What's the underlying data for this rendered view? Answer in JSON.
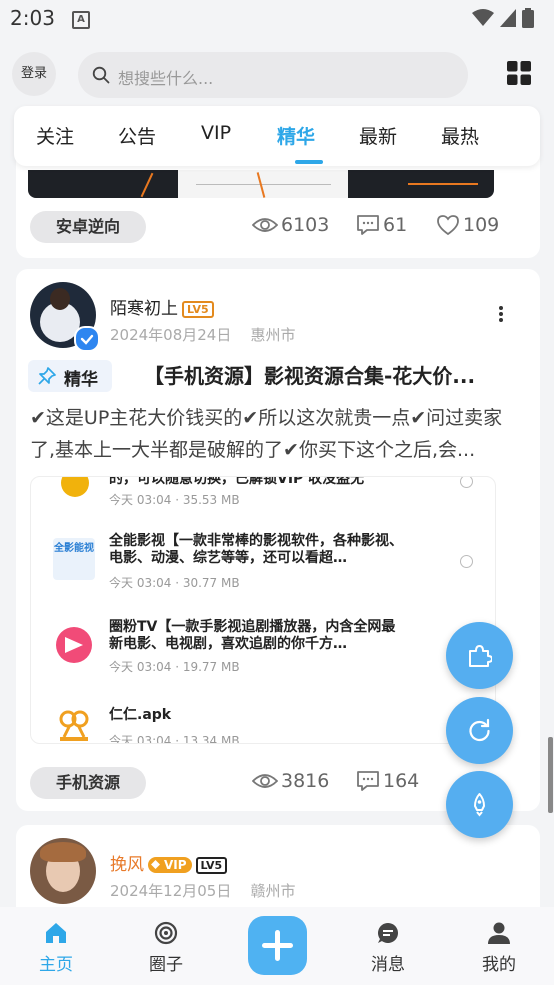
{
  "status_bar": {
    "time": "2:03",
    "notification_badge": "A"
  },
  "header": {
    "login_label": "登录",
    "search_placeholder": "想搜些什么..."
  },
  "tabs": [
    {
      "label": "关注"
    },
    {
      "label": "公告"
    },
    {
      "label": "VIP"
    },
    {
      "label": "精华",
      "active": true
    },
    {
      "label": "最新"
    },
    {
      "label": "最热"
    }
  ],
  "card1": {
    "tag": "安卓逆向",
    "views": "6103",
    "comments": "61",
    "likes": "109"
  },
  "card2": {
    "user": "陌寒初上",
    "level": "LV5",
    "date": "2024年08月24日",
    "location": "惠州市",
    "badge": "精华",
    "title": "【手机资源】影视资源合集-花大价...",
    "body": "✔这是UP主花大价钱买的✔所以这次就贵一点✔问过卖家了,基本上一大半都是破解的了✔你买下这个之后,会...",
    "files": [
      {
        "title": "的，可以随意切换，已解锁VIP 收没盗无",
        "meta": "今天 03:04 · 35.53 MB"
      },
      {
        "title": "全能影视【一款非常棒的影视软件，各种影视、电影、动漫、综艺等等，还可以看超…",
        "meta": "今天 03:04 · 30.77 MB",
        "icon_text": "全影能视"
      },
      {
        "title": "圈粉TV【一款手影视追剧播放器，内含全网最新电影、电视剧，喜欢追剧的你千方…",
        "meta": "今天 03:04 · 19.77 MB"
      },
      {
        "title": "仁仁.apk",
        "meta": "今天 03:04 · 13.34 MB"
      }
    ],
    "tag": "手机资源",
    "views": "3816",
    "comments": "164"
  },
  "card3": {
    "user": "挽风",
    "vip": "VIP",
    "level": "LV5",
    "date": "2024年12月05日",
    "location": "赣州市"
  },
  "bottom_nav": [
    {
      "label": "主页",
      "icon": "home-icon"
    },
    {
      "label": "圈子",
      "icon": "circle-icon"
    },
    {
      "label": "消息",
      "icon": "message-icon"
    },
    {
      "label": "我的",
      "icon": "user-icon"
    }
  ],
  "colors": {
    "accent": "#2ea7e8",
    "fab": "#55aef0",
    "level": "#e38a1e",
    "vip": "#f0a020"
  }
}
